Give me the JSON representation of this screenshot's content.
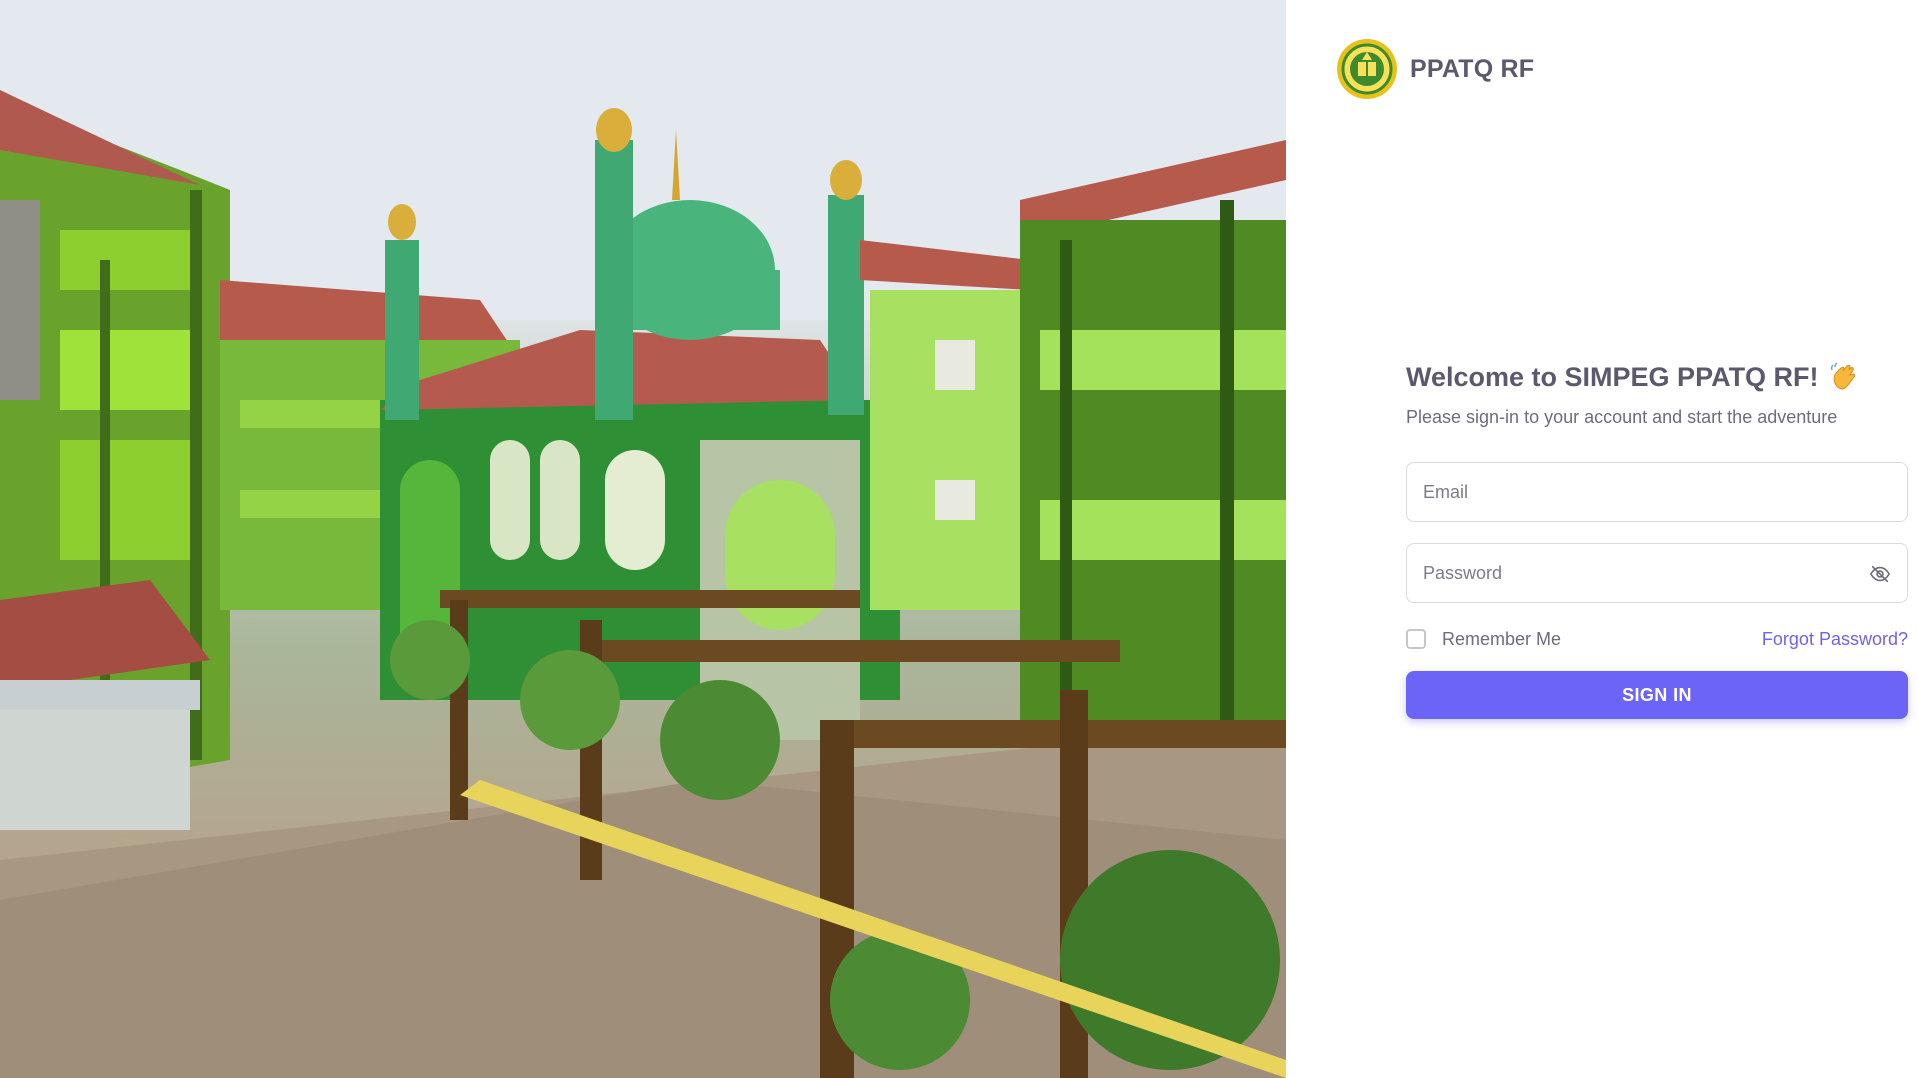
{
  "brand": {
    "name": "PPATQ RF",
    "logo_icon": "ppatq-rf-logo"
  },
  "hero": {
    "image_description_icon": "school-mosque-photo"
  },
  "login": {
    "title": "Welcome to SIMPEG PPATQ RF!",
    "title_icon": "waving-hand-emoji",
    "subtitle": "Please sign-in to your account and start the adventure",
    "email_placeholder": "Email",
    "password_placeholder": "Password",
    "password_toggle_icon": "eye-off-icon",
    "remember_label": "Remember Me",
    "remember_checked": false,
    "forgot_label": "Forgot Password?",
    "submit_label": "SIGN IN"
  },
  "colors": {
    "primary": "#6c63f7",
    "heading": "#5d596c",
    "body_text": "#6f6b7d",
    "border": "#dbdade"
  }
}
